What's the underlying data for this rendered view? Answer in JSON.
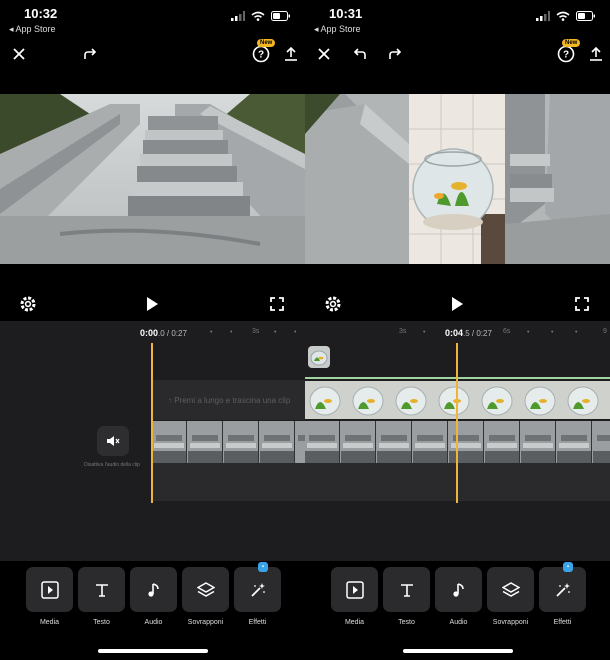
{
  "left": {
    "status": {
      "time": "10:32",
      "back_label": "◂ App Store"
    },
    "toolbar": {
      "new_badge": "New"
    },
    "timeline": {
      "current_time": "0:00",
      "time_rest": ".0 / 0:27",
      "ticks": [
        "3s"
      ],
      "hint": "↑ Premi a lungo e trascina una clip",
      "mute_label": "Disattiva l'audio della clip"
    },
    "tools": [
      "Media",
      "Testo",
      "Audio",
      "Sovrapponi",
      "Effetti"
    ]
  },
  "right": {
    "status": {
      "time": "10:31",
      "back_label": "◂ App Store"
    },
    "toolbar": {
      "new_badge": "New"
    },
    "timeline": {
      "current_time": "0:04",
      "time_rest": ".5 / 0:27",
      "ticks": [
        "3s",
        "6s",
        "9"
      ]
    },
    "tools": [
      "Media",
      "Testo",
      "Audio",
      "Sovrapponi",
      "Effetti"
    ]
  },
  "colors": {
    "playhead": "#f0b43c",
    "new_badge": "#f3b721",
    "effects_badge": "#3aa3e8",
    "audio_line": "#9fd39f"
  },
  "icons": [
    "close-icon",
    "redo-icon",
    "undo-icon",
    "help-icon",
    "export-icon",
    "settings-icon",
    "play-icon",
    "fullscreen-icon",
    "mute-icon",
    "media-icon",
    "text-icon",
    "audio-icon",
    "layers-icon",
    "magic-wand-icon"
  ]
}
